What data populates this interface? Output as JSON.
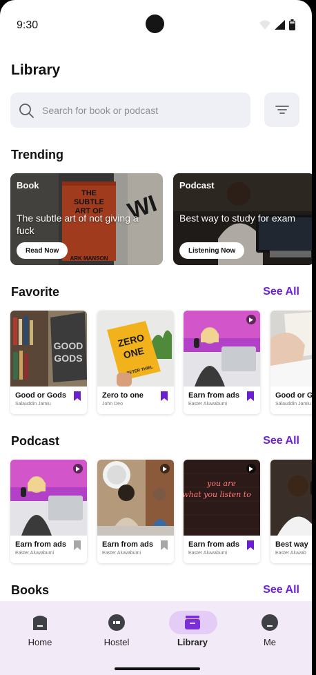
{
  "status_bar": {
    "time": "9:30"
  },
  "page": {
    "title": "Library"
  },
  "search": {
    "placeholder": "Search for book or podcast"
  },
  "sections": {
    "trending": "Trending",
    "favorite": "Favorite",
    "podcast": "Podcast",
    "books": "Books",
    "see_all": "See All"
  },
  "trending": [
    {
      "tag": "Book",
      "title": "The subtle art of not giving a fuck",
      "button": "Read Now",
      "cover_text": "THE SUBTLE ART OF NOT GIVING A F*CK",
      "cover_author": "MARK MANSON"
    },
    {
      "tag": "Podcast",
      "title": "Best way to study for exam",
      "button": "Listening Now"
    }
  ],
  "favorite": [
    {
      "title": "Good or Gods",
      "author": "Salauddin Jamiu",
      "bookmarked": true,
      "type": "book"
    },
    {
      "title": "Zero to one",
      "author": "John Deo",
      "bookmarked": true,
      "type": "book",
      "cover_text": "ZERO TO ONE",
      "cover_author": "PETER THIEL"
    },
    {
      "title": "Earn from ads",
      "author": "Easter Aluwabumi",
      "bookmarked": true,
      "type": "podcast"
    },
    {
      "title": "Good or G",
      "author": "Salauddin Jamiu",
      "bookmarked": false,
      "type": "book"
    }
  ],
  "podcast": [
    {
      "title": "Earn from ads",
      "author": "Easter Aluwabumi",
      "bookmarked": false
    },
    {
      "title": "Earn from ads",
      "author": "Easter Aluwabumi",
      "bookmarked": false
    },
    {
      "title": "Earn from ads",
      "author": "Easter Aluwabumi",
      "bookmarked": true,
      "neon_text": "you are what you listen to"
    },
    {
      "title": "Best way",
      "author": "Easter Aluwab",
      "bookmarked": false
    }
  ],
  "nav": [
    {
      "label": "Home",
      "icon": "home-icon",
      "active": false
    },
    {
      "label": "Hostel",
      "icon": "hostel-icon",
      "active": false
    },
    {
      "label": "Library",
      "icon": "library-icon",
      "active": true
    },
    {
      "label": "Me",
      "icon": "profile-icon",
      "active": false
    }
  ],
  "colors": {
    "accent": "#6a1fd1",
    "nav_bg": "#f3eaf8",
    "nav_active": "#e3cdf6",
    "bookmark_off": "#a7a7a7"
  }
}
